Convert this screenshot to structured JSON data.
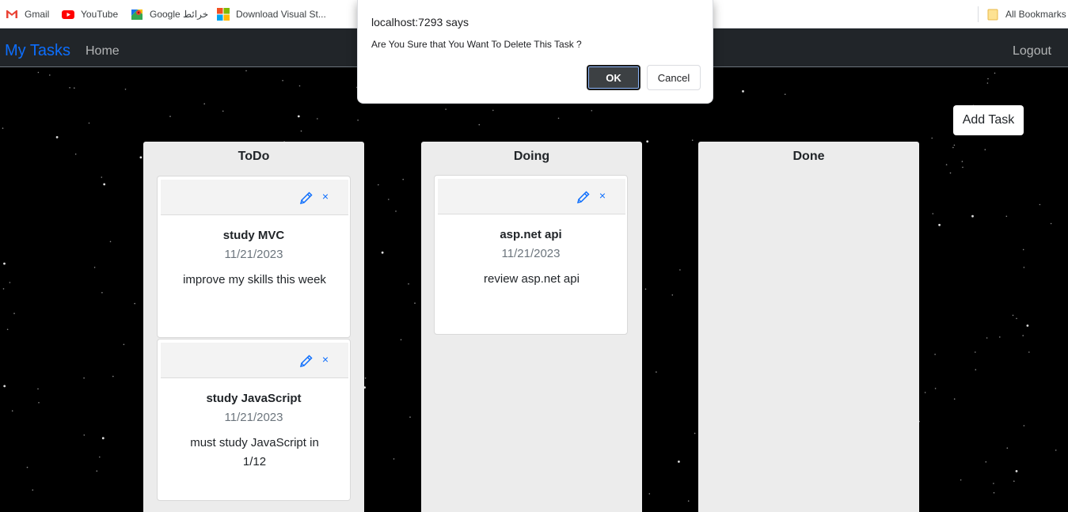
{
  "bookmarks": {
    "items": [
      {
        "label": "Gmail",
        "icon": "gmail-icon"
      },
      {
        "label": "YouTube",
        "icon": "youtube-icon"
      },
      {
        "label": "Google خرائط",
        "icon": "google-maps-icon"
      },
      {
        "label": "Download Visual St...",
        "icon": "windows-icon"
      }
    ],
    "all_label": "All Bookmarks"
  },
  "navbar": {
    "brand": "My Tasks",
    "home": "Home",
    "logout": "Logout",
    "brand_color": "#0d6efd",
    "bg_color": "#212529"
  },
  "add_task_label": "Add Task",
  "columns": [
    {
      "title": "ToDo",
      "cards": [
        {
          "title": "study MVC",
          "date": "11/21/2023",
          "description": "improve my skills this week"
        },
        {
          "title": "study JavaScript",
          "date": "11/21/2023",
          "description": "must study JavaScript in 1/12"
        }
      ]
    },
    {
      "title": "Doing",
      "cards": [
        {
          "title": "asp.net api",
          "date": "11/21/2023",
          "description": "review asp.net api"
        }
      ]
    },
    {
      "title": "Done",
      "cards": []
    }
  ],
  "icons": {
    "edit": "pencil-icon",
    "delete": "close-icon",
    "delete_glyph": "×"
  },
  "dialog": {
    "title": "localhost:7293 says",
    "message": "Are You Sure that You Want To Delete This Task ?",
    "ok_label": "OK",
    "cancel_label": "Cancel"
  }
}
